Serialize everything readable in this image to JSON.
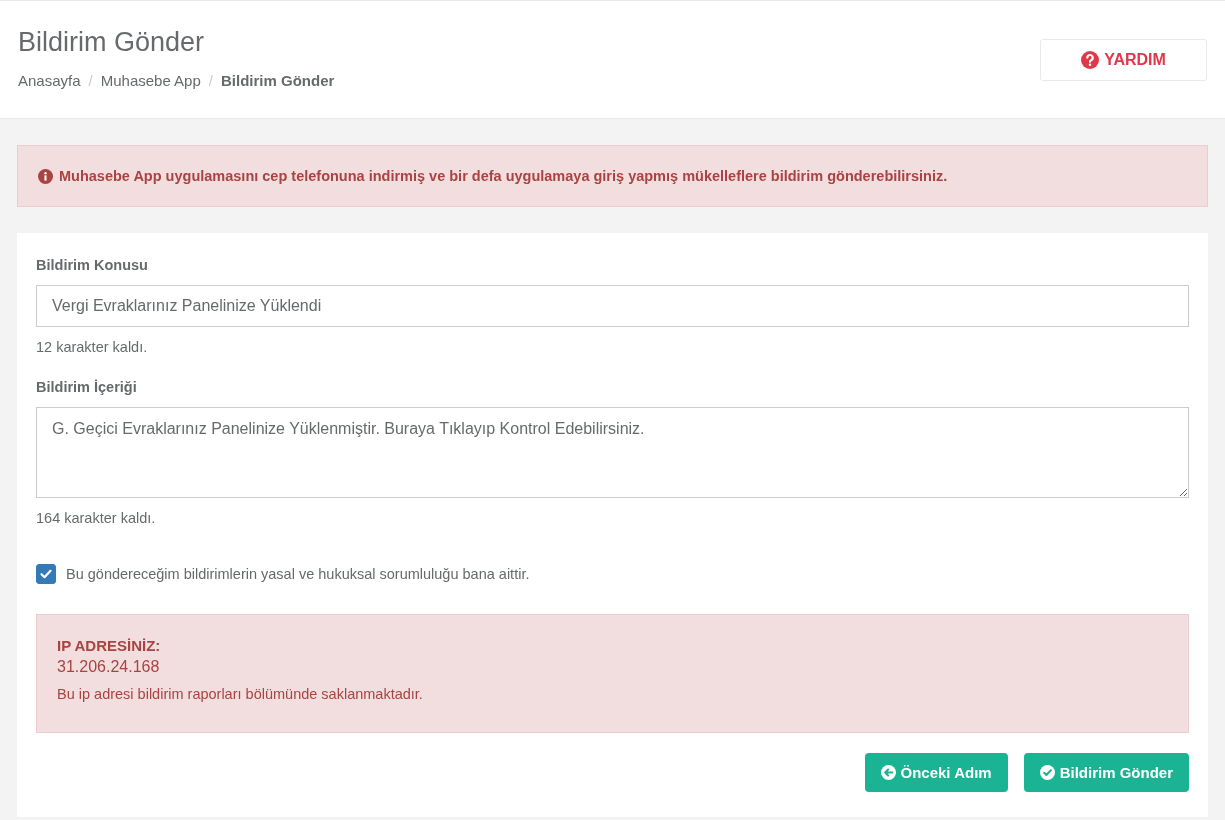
{
  "page_title": "Bildirim Gönder",
  "breadcrumb": [
    {
      "label": "Anasayfa",
      "current": false
    },
    {
      "label": "Muhasebe App",
      "current": false
    },
    {
      "label": "Bildirim Gönder",
      "current": true
    }
  ],
  "breadcrumb_separator": "/",
  "help_button": "YARDIM",
  "info_alert": "Muhasebe App uygulamasını cep telefonuna indirmiş ve bir defa uygulamaya giriş yapmış mükelleflere bildirim gönderebilirsiniz.",
  "form": {
    "subject_label": "Bildirim Konusu",
    "subject_value": "Vergi Evraklarınız Panelinize Yüklendi",
    "subject_counter": "12 karakter kaldı.",
    "content_label": "Bildirim İçeriği",
    "content_value": "G. Geçici Evraklarınız Panelinize Yüklenmiştir. Buraya Tıklayıp Kontrol Edebilirsiniz.",
    "content_counter": "164 karakter kaldı.",
    "consent": {
      "label": "Bu göndereceğim bildirimlerin yasal ve hukuksal sorumluluğu bana aittir.",
      "checked": true
    }
  },
  "ip_box": {
    "title": "IP ADRESİNİZ:",
    "address": "31.206.24.168",
    "note": "Bu ip adresi bildirim raporları bölümünde saklanmaktadır."
  },
  "buttons": [
    {
      "label": "Önceki Adım",
      "kind": "back"
    },
    {
      "label": "Bildirim Gönder",
      "kind": "submit"
    }
  ]
}
